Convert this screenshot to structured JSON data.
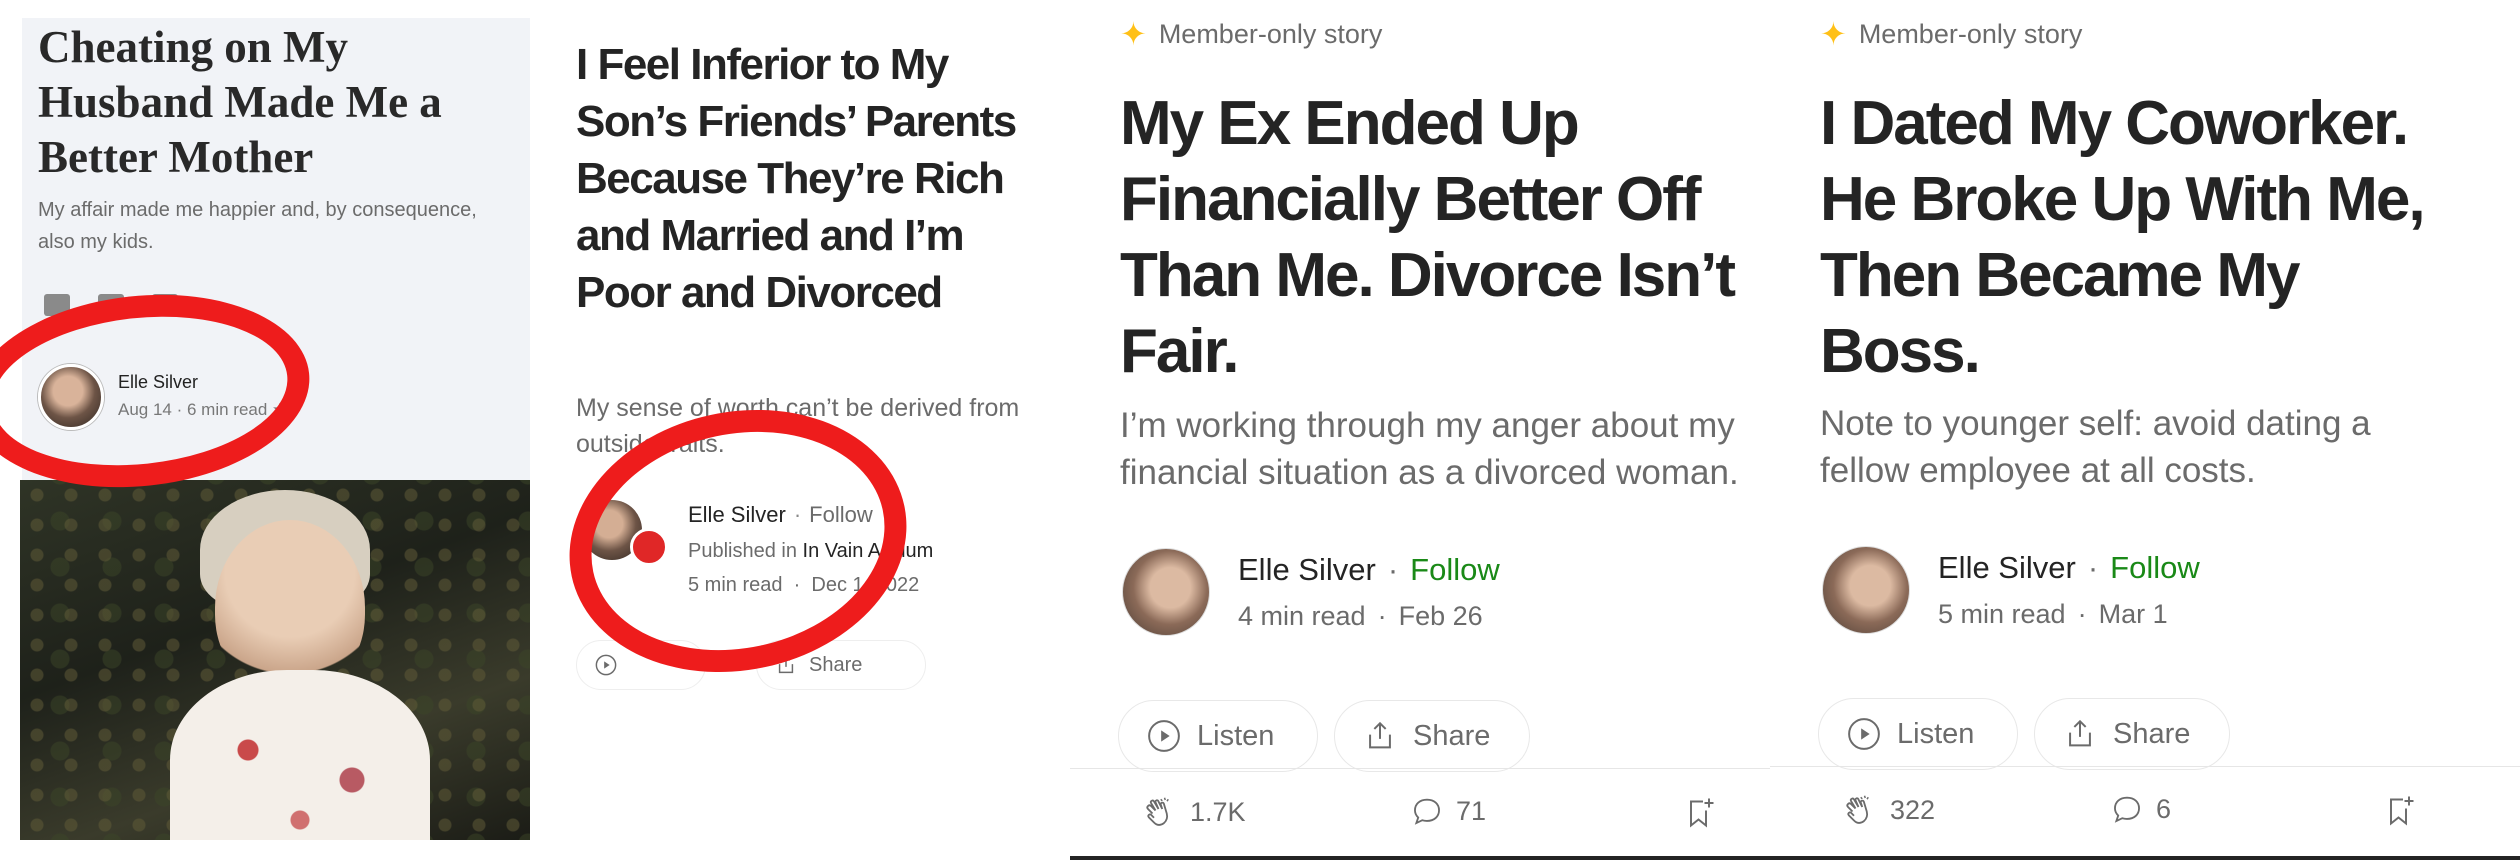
{
  "panel1": {
    "title": "Cheating on My Husband Made Me a Better Mother",
    "subtitle": "My affair made me happier and, by consequence, also my kids.",
    "author": "Elle Silver",
    "meta": "Aug 14 · 6 min read ★"
  },
  "panel2": {
    "title": "I Feel Inferior to My Son’s Friends’ Parents Because They’re Rich and Married and I’m Poor and Divorced",
    "subtitle": "My sense of worth can’t be derived from outside traits.",
    "author": "Elle Silver",
    "follow": "Follow",
    "published_prefix": "Published in",
    "publication": "In Vain Asylum",
    "read_time": "5 min read",
    "date": "Dec 1, 2022",
    "share_label": "Share"
  },
  "panel3": {
    "member_label": "Member-only story",
    "title": "My Ex Ended Up Financially Better Off Than Me. Divorce Isn’t Fair.",
    "subtitle": "I’m working through my anger about my financial situation as a divorced woman.",
    "author": "Elle Silver",
    "follow": "Follow",
    "read_time": "4 min read",
    "date": "Feb 26",
    "listen_label": "Listen",
    "share_label": "Share",
    "claps": "1.7K",
    "responses": "71"
  },
  "panel4": {
    "member_label": "Member-only story",
    "title": "I Dated My Coworker. He Broke Up With Me, Then Became My Boss.",
    "subtitle": "Note to younger self: avoid dating a fellow employee at all costs.",
    "author": "Elle Silver",
    "follow": "Follow",
    "read_time": "5 min read",
    "date": "Mar 1",
    "listen_label": "Listen",
    "share_label": "Share",
    "claps": "322",
    "responses": "6"
  },
  "colors": {
    "follow_green": "#1a8917",
    "member_star": "#ffc017",
    "annotation_red": "#ee1c1c",
    "text_primary": "#242424",
    "text_secondary": "#6b6b6b"
  },
  "icons": [
    "star-icon",
    "play-icon",
    "share-icon",
    "clap-icon",
    "response-icon",
    "bookmark-add-icon",
    "twitter-icon",
    "linkedin-icon",
    "facebook-icon"
  ]
}
